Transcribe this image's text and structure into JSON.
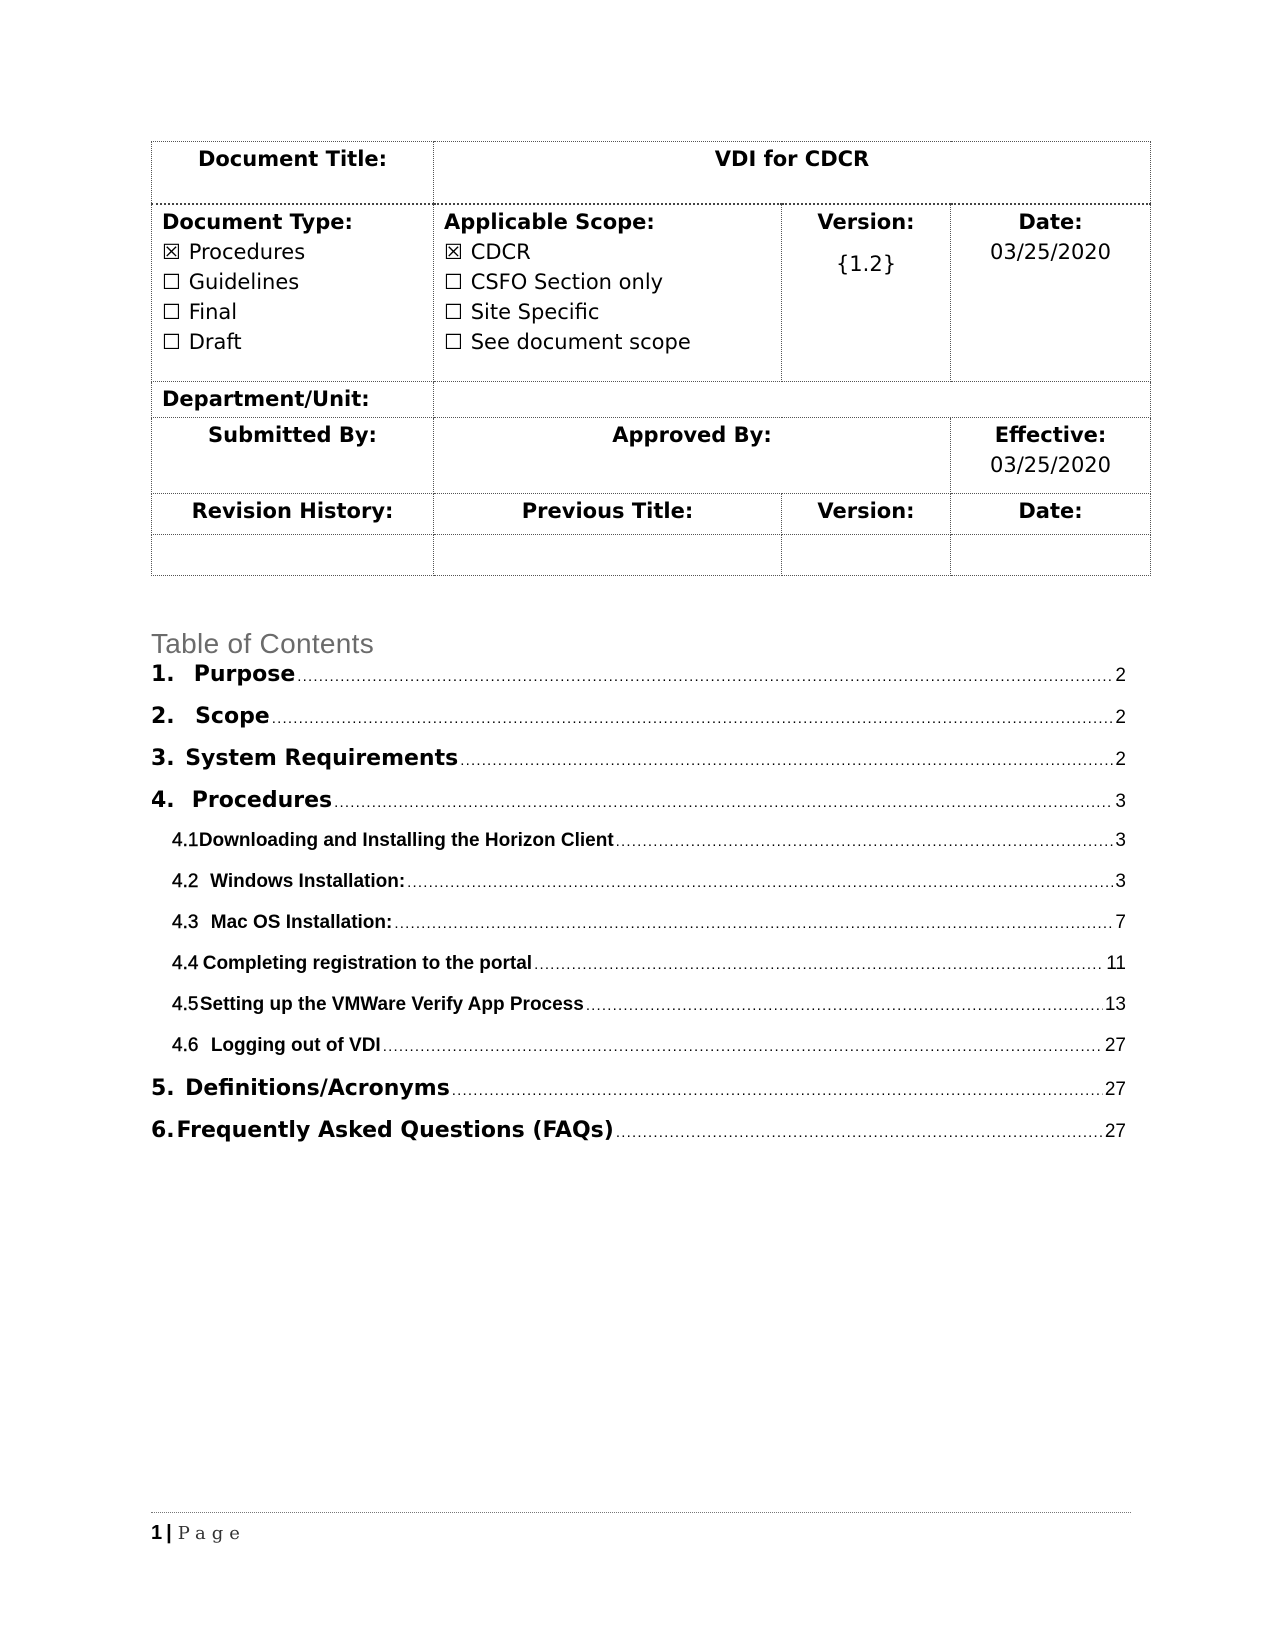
{
  "header_table": {
    "document_title_label": "Document Title:",
    "document_title_value": "VDI for CDCR",
    "document_type": {
      "label": "Document Type:",
      "options": [
        {
          "label": "Procedures",
          "checked": true,
          "box": "☒"
        },
        {
          "label": "Guidelines",
          "checked": false,
          "box": "☐"
        },
        {
          "label": "Final",
          "checked": false,
          "box": "☐"
        },
        {
          "label": "Draft",
          "checked": false,
          "box": "☐"
        }
      ]
    },
    "applicable_scope": {
      "label": "Applicable Scope:",
      "options": [
        {
          "label": "CDCR",
          "checked": true,
          "box": "☒"
        },
        {
          "label": "CSFO Section only",
          "checked": false,
          "box": "☐"
        },
        {
          "label": "Site Specific",
          "checked": false,
          "box": "☐"
        },
        {
          "label": "See document scope",
          "checked": false,
          "box": "☐"
        }
      ]
    },
    "version_label": "Version:",
    "version_value": "{1.2}",
    "date_label": "Date:",
    "date_value": "03/25/2020",
    "department_label": "Department/Unit:",
    "department_value": "",
    "submitted_by_label": "Submitted By:",
    "approved_by_label": "Approved By:",
    "effective_label": "Effective:",
    "effective_value": "03/25/2020",
    "revision_history_label": "Revision History:",
    "previous_title_label": "Previous Title:",
    "revision_version_label": "Version:",
    "revision_date_label": "Date:"
  },
  "toc": {
    "title": "Table of Contents",
    "entries": [
      {
        "num": "1.",
        "label": "Purpose",
        "page": "2",
        "level": 1
      },
      {
        "num": "2.",
        "label": "Scope",
        "page": "2",
        "level": 1
      },
      {
        "num": "3.",
        "label": "System Requirements",
        "page": "2",
        "level": 1
      },
      {
        "num": "4.",
        "label": "Procedures",
        "page": "3",
        "level": 1
      },
      {
        "num": "4.1",
        "label": "Downloading and Installing the Horizon Client",
        "page": "3",
        "level": 2
      },
      {
        "num": "4.2",
        "label": "Windows Installation:",
        "page": "3",
        "level": 2
      },
      {
        "num": "4.3",
        "label": "Mac OS Installation:",
        "page": "7",
        "level": 2
      },
      {
        "num": "4.4",
        "label": "Completing registration to the portal",
        "page": "11",
        "level": 2
      },
      {
        "num": "4.5",
        "label": "Setting up the VMWare Verify App Process",
        "page": "13",
        "level": 2
      },
      {
        "num": "4.6",
        "label": "Logging out of VDI",
        "page": "27",
        "level": 2
      },
      {
        "num": "5.",
        "label": "Definitions/Acronyms",
        "page": "27",
        "level": 1
      },
      {
        "num": "6.",
        "label": "Frequently Asked Questions (FAQs)",
        "page": "27",
        "level": 1
      }
    ]
  },
  "footer": {
    "page_number": "1",
    "separator": "|",
    "page_label": "Page"
  }
}
